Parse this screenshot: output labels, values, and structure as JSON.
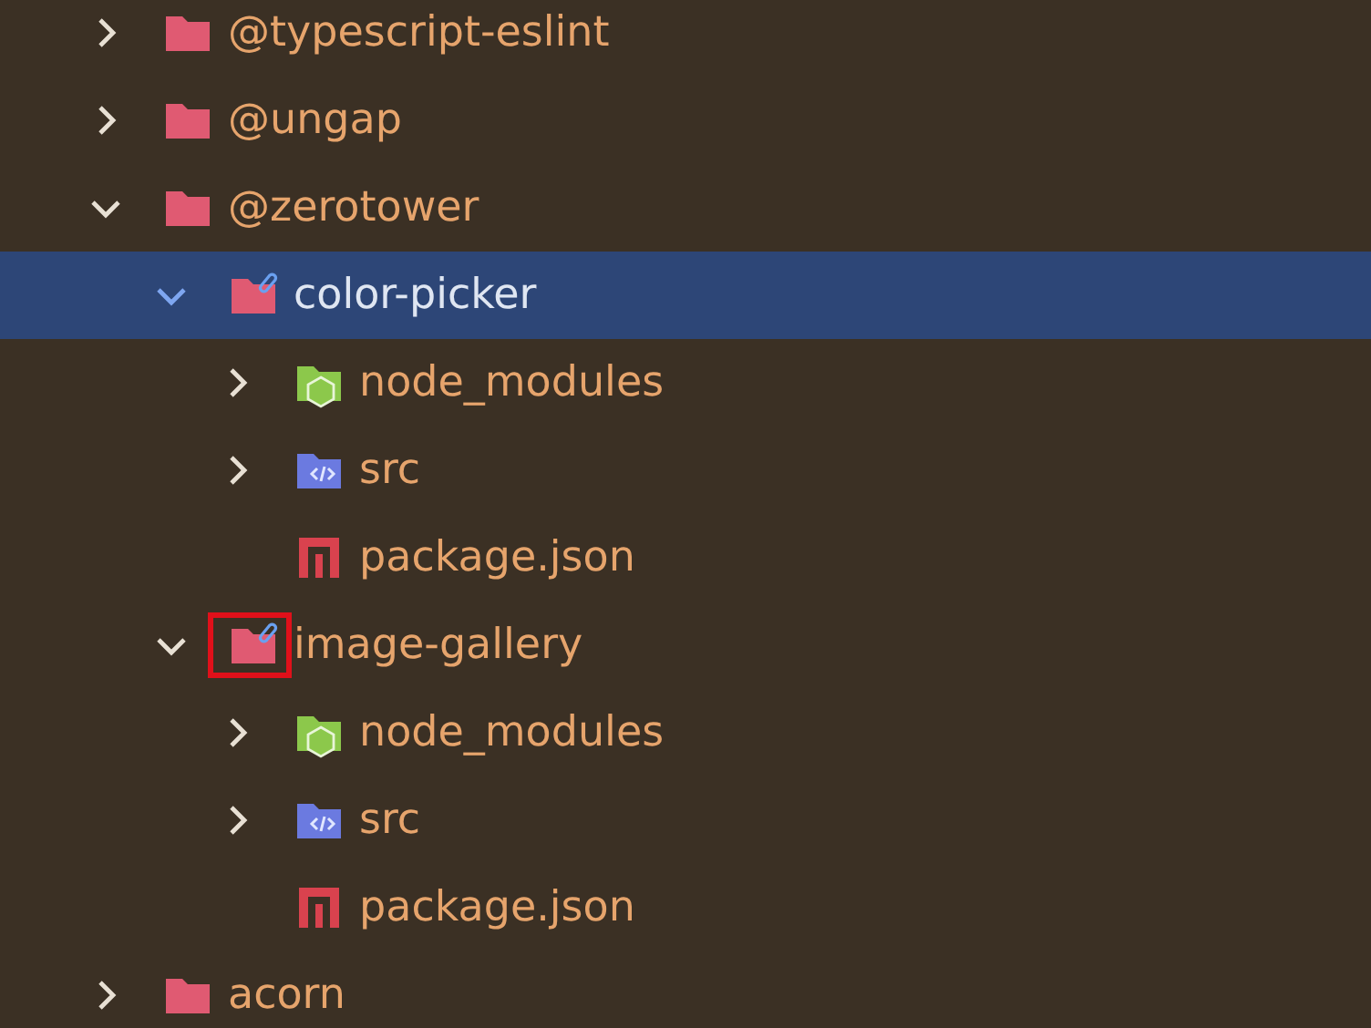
{
  "tree": [
    {
      "label": "@typescript-eslint",
      "kind": "folder",
      "expanded": false,
      "selected": false
    },
    {
      "label": "@ungap",
      "kind": "folder",
      "expanded": false,
      "selected": false
    },
    {
      "label": "@zerotower",
      "kind": "folder",
      "expanded": true,
      "selected": false,
      "children": [
        {
          "label": "color-picker",
          "kind": "linked-folder",
          "expanded": true,
          "selected": true,
          "marked": false,
          "children": [
            {
              "label": "node_modules",
              "kind": "node-folder",
              "expanded": false,
              "selected": false
            },
            {
              "label": "src",
              "kind": "src-folder",
              "expanded": false,
              "selected": false
            },
            {
              "label": "package.json",
              "kind": "npm-file",
              "selected": false
            }
          ]
        },
        {
          "label": "image-gallery",
          "kind": "linked-folder",
          "expanded": true,
          "selected": false,
          "marked": true,
          "children": [
            {
              "label": "node_modules",
              "kind": "node-folder",
              "expanded": false,
              "selected": false
            },
            {
              "label": "src",
              "kind": "src-folder",
              "expanded": false,
              "selected": false
            },
            {
              "label": "package.json",
              "kind": "npm-file",
              "selected": false
            }
          ]
        }
      ]
    },
    {
      "label": "acorn",
      "kind": "folder",
      "expanded": false,
      "selected": false
    }
  ]
}
